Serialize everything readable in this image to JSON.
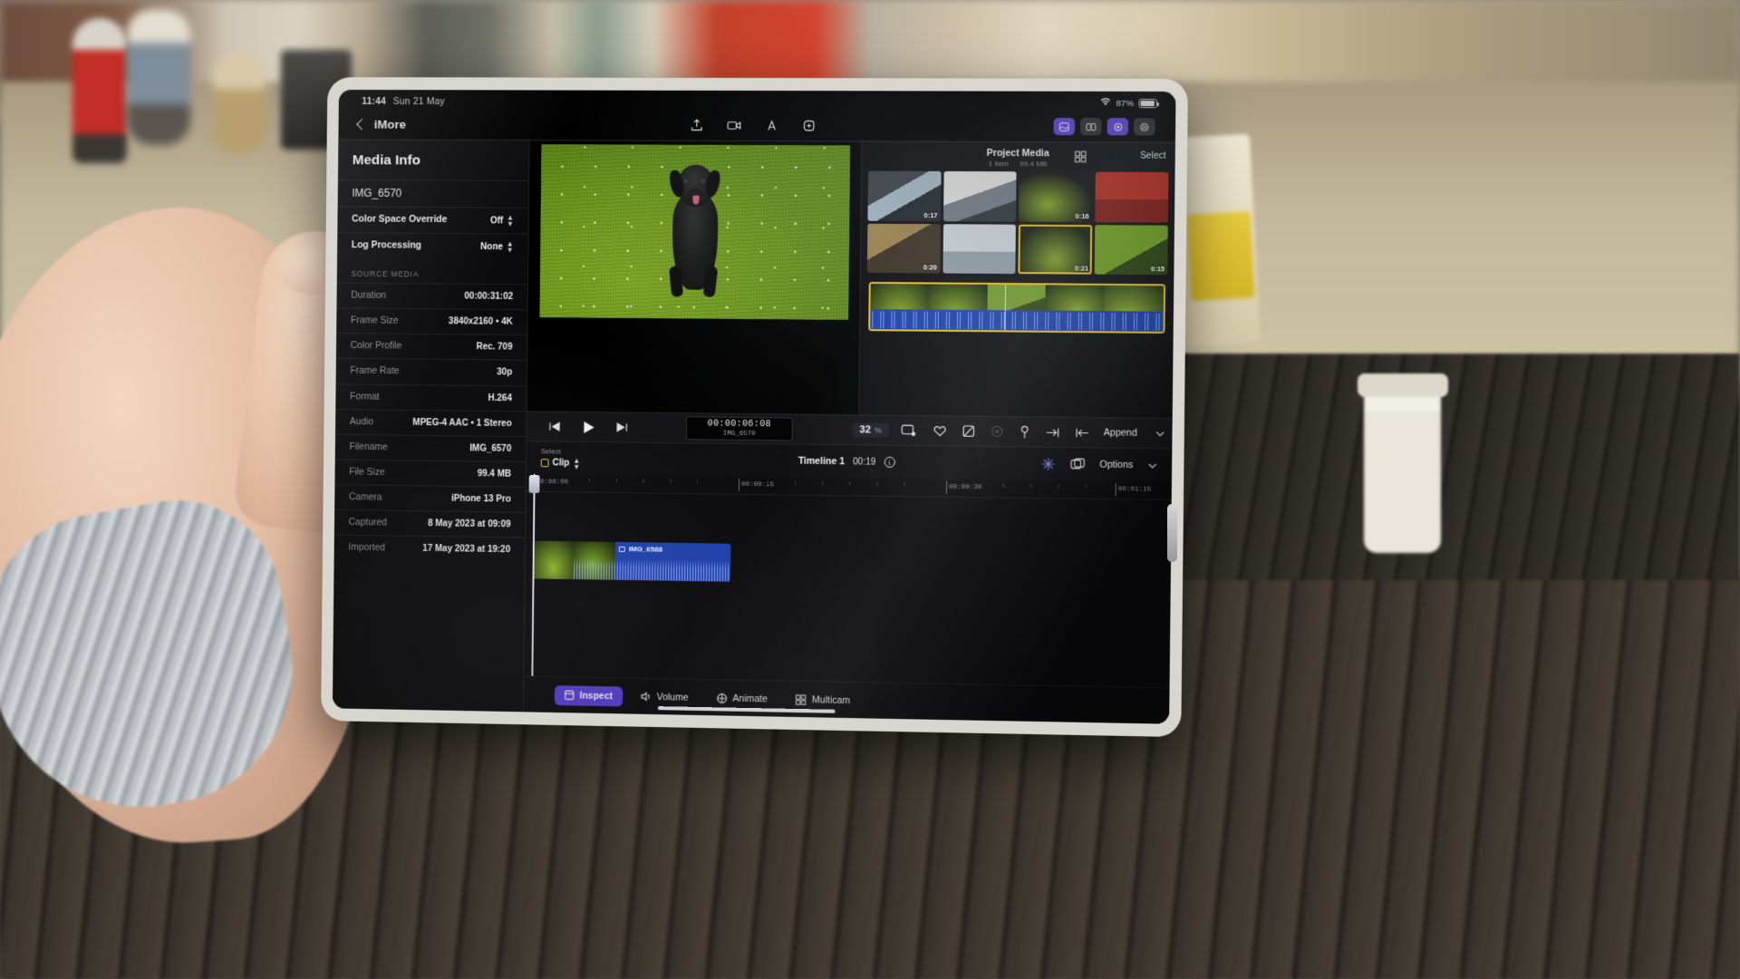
{
  "device": {
    "status_bar": {
      "time": "11:44",
      "date": "Sun 21 May",
      "battery": "87%"
    }
  },
  "nav": {
    "back_title": "iMore",
    "center_icons": [
      "export-icon",
      "camera-icon",
      "titles-icon",
      "share-icon"
    ],
    "right_icons": [
      "media-library-icon",
      "transitions-icon",
      "audio-icon",
      "settings-icon"
    ]
  },
  "inspector": {
    "title": "Media Info",
    "clip_name": "IMG_6570",
    "settings": [
      {
        "label": "Color Space Override",
        "value": "Off",
        "control": "stepper"
      },
      {
        "label": "Log Processing",
        "value": "None",
        "control": "stepper"
      }
    ],
    "section_title": "SOURCE MEDIA",
    "rows": [
      {
        "label": "Duration",
        "value": "00:00:31:02"
      },
      {
        "label": "Frame Size",
        "value": "3840x2160 • 4K"
      },
      {
        "label": "Color Profile",
        "value": "Rec. 709"
      },
      {
        "label": "Frame Rate",
        "value": "30p"
      },
      {
        "label": "Format",
        "value": "H.264"
      },
      {
        "label": "Audio",
        "value": "MPEG-4 AAC • 1 Stereo"
      },
      {
        "label": "Filename",
        "value": "IMG_6570"
      },
      {
        "label": "File Size",
        "value": "99.4 MB"
      },
      {
        "label": "Camera",
        "value": "iPhone 13 Pro"
      },
      {
        "label": "Captured",
        "value": "8 May 2023 at 09:09"
      },
      {
        "label": "Imported",
        "value": "17 May 2023 at 19:20"
      }
    ]
  },
  "media_panel": {
    "title": "Project Media",
    "item_count": "1 item",
    "size": "99.4 MB",
    "select_label": "Select",
    "grid_icon": "grid-view-icon",
    "thumbnails": [
      {
        "duration": "0:17",
        "style": "t1",
        "selected": false
      },
      {
        "duration": "",
        "style": "t2",
        "selected": false
      },
      {
        "duration": "0:16",
        "style": "t3",
        "selected": false
      },
      {
        "duration": "",
        "style": "t4",
        "selected": false
      },
      {
        "duration": "0:20",
        "style": "t5",
        "selected": false
      },
      {
        "duration": "",
        "style": "t6",
        "selected": false
      },
      {
        "duration": "0:21",
        "style": "t7",
        "selected": true
      },
      {
        "duration": "0:15",
        "style": "t9",
        "selected": false
      }
    ]
  },
  "transport": {
    "prev_frame_icon": "step-back-icon",
    "play_icon": "play-icon",
    "next_frame_icon": "step-forward-icon",
    "timecode": "00:00:06:08",
    "timecode_clip": "IMG_6570",
    "zoom_value": "32",
    "zoom_unit": "%",
    "crop_icon": "crop-icon",
    "actions": [
      "favorite-icon",
      "reject-icon",
      "clear-icon",
      "keyframe-icon",
      "goto-end-icon",
      "goto-start-icon"
    ],
    "append_label": "Append",
    "append_chevron": "chevron-down-icon"
  },
  "timeline_header": {
    "select_label": "Select",
    "clip_label": "Clip",
    "name": "Timeline 1",
    "duration": "00:19",
    "info_icon": "info-icon",
    "keyframe_icon": "keyframes-icon",
    "overlay_icon": "overlay-icon",
    "options_label": "Options",
    "options_chevron": "chevron-down-icon"
  },
  "timeline": {
    "ruler_labels": [
      "00:00:00",
      "00:00:15",
      "00:00:30",
      "00:01:15"
    ],
    "playhead_position": "00:00:00",
    "clips": [
      {
        "name": "IMG_6588",
        "icon": "video-clip-icon"
      }
    ]
  },
  "bottom_toolbar": {
    "tools": [
      {
        "label": "Inspect",
        "icon": "inspect-icon",
        "active": true
      },
      {
        "label": "Volume",
        "icon": "volume-icon",
        "active": false
      },
      {
        "label": "Animate",
        "icon": "animate-icon",
        "active": false
      },
      {
        "label": "Multicam",
        "icon": "multicam-icon",
        "active": false
      }
    ]
  },
  "colors": {
    "accent_purple": "#5b3fd6",
    "selection_yellow": "#e8c21c",
    "audio_blue": "#1c3ea8",
    "background": "#0a0a0d"
  }
}
